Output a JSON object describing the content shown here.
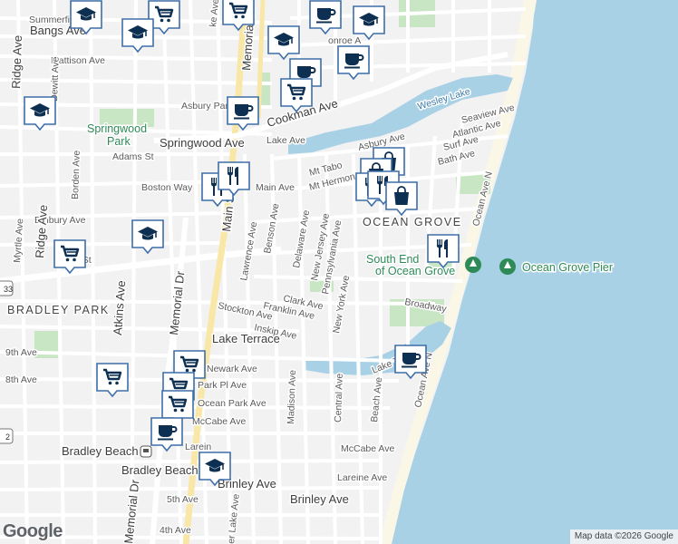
{
  "map": {
    "colors": {
      "land": "#f2f2f2",
      "water": "#a9d1e6",
      "park": "#c8e6c4",
      "road": "#ffffff",
      "major_road": "#f8e7a6",
      "marker_stroke": "#3d6ea8",
      "marker_glyph": "#0c2f52"
    },
    "areas": {
      "ocean_grove": "OCEAN GROVE",
      "bradley_park": "BRADLEY PARK",
      "bradley_beach": "Bradley Beach"
    },
    "parks": {
      "springwood_park_1": "Springwood",
      "springwood_park_2": "Park",
      "south_end_1": "South End",
      "south_end_2": "of Ocean Grove",
      "ocean_grove_pier": "Ocean Grove Pier"
    },
    "water": {
      "wesley_lake": "Wesley Lake"
    },
    "streets": {
      "summerfield": "Summerfi",
      "bangs": "Bangs Ave",
      "mattison": "Mattison Ave",
      "ridge_top": "Ridge Ave",
      "dewitt": "Dewitt Ave",
      "asbury_park_st": "Asbury Park",
      "cookman": "Cookman Ave",
      "springwood_ave": "Springwood Ave",
      "lake_ave": "Lake Ave",
      "adams": "Adams St",
      "boston": "Boston Way",
      "borden": "Borden Ave",
      "main_ave": "Main Ave",
      "main_st": "Main St",
      "embury": "Embury Ave",
      "ridge_mid": "Ridge Ave",
      "myrtle": "Myrtle Ave",
      "memorial_top": "Memorial Dr",
      "memorial_mid": "Memorial Dr",
      "memorial_bot": "Memorial Dr",
      "atkins": "Atkins Ave",
      "lawrence": "Lawrence Ave",
      "benson": "Benson Ave",
      "delaware": "Delaware Ave",
      "new_jersey": "New Jersey Ave",
      "pennsylvania": "Pennsylvania Ave",
      "new_york": "New York Ave",
      "clark": "Clark Ave",
      "franklin": "Franklin Ave",
      "stockton": "Stockton Ave",
      "inskip": "Inskip Ave",
      "lake_terrace": "Lake Terrace",
      "lake_terrace_east": "Lake Terrace",
      "ninth": "9th Ave",
      "eighth": "8th Ave",
      "newark": "Newark Ave",
      "park_pl": "Park Pl Ave",
      "ocean_park": "Ocean Park Ave",
      "mccabe_west": "McCabe Ave",
      "mccabe_east": "McCabe Ave",
      "madison": "Madison Ave",
      "central": "Central Ave",
      "beach": "Beach Ave",
      "ocean_ave_n": "Ocean Ave N",
      "ocean_ave_n2": "Ocean Ave N",
      "larein": "Larein",
      "lareine": "Lareine Ave",
      "brinley_west": "Brinley Ave",
      "brinley_east": "Brinley Ave",
      "fifth": "5th Ave",
      "fourth": "4th Ave",
      "fletcher": "er Lake Ave",
      "broadway": "Broadway",
      "asbury_ave": "Asbury Ave",
      "seaview": "Seaview Ave",
      "atlantic": "Atlantic Ave",
      "surf": "Surf Ave",
      "bath": "Bath Ave",
      "mt_tabor": "Mt Tabo",
      "mt_hermon": "Mt Hermon",
      "monroe": "onroe A",
      "heck": "h St",
      "main_st_east": "n St",
      "lake_ave_top": "ke Ave"
    },
    "route_badges": {
      "r33": "33",
      "r2": "2"
    },
    "markers": [
      {
        "icon": "shopping-cart-icon"
      },
      {
        "icon": "school-icon"
      },
      {
        "icon": "school-icon"
      },
      {
        "icon": "shopping-cart-icon"
      },
      {
        "icon": "coffee-icon"
      },
      {
        "icon": "school-icon"
      },
      {
        "icon": "school-icon"
      },
      {
        "icon": "coffee-icon"
      },
      {
        "icon": "coffee-icon"
      },
      {
        "icon": "shopping-cart-icon"
      },
      {
        "icon": "school-icon"
      },
      {
        "icon": "coffee-icon"
      },
      {
        "icon": "restaurant-icon"
      },
      {
        "icon": "restaurant-icon"
      },
      {
        "icon": "school-icon"
      },
      {
        "icon": "shopping-cart-icon"
      },
      {
        "icon": "shopping-bag-icon"
      },
      {
        "icon": "shopping-bag-icon"
      },
      {
        "icon": "restaurant-icon"
      },
      {
        "icon": "restaurant-icon"
      },
      {
        "icon": "shopping-bag-icon"
      },
      {
        "icon": "restaurant-icon"
      },
      {
        "icon": "coffee-icon"
      },
      {
        "icon": "shopping-cart-icon"
      },
      {
        "icon": "shopping-cart-icon"
      },
      {
        "icon": "shopping-cart-icon"
      },
      {
        "icon": "shopping-cart-icon"
      },
      {
        "icon": "coffee-icon"
      },
      {
        "icon": "school-icon"
      }
    ]
  },
  "footer": {
    "google_logo": "Google",
    "attribution": "Map data ©2026 Google"
  }
}
